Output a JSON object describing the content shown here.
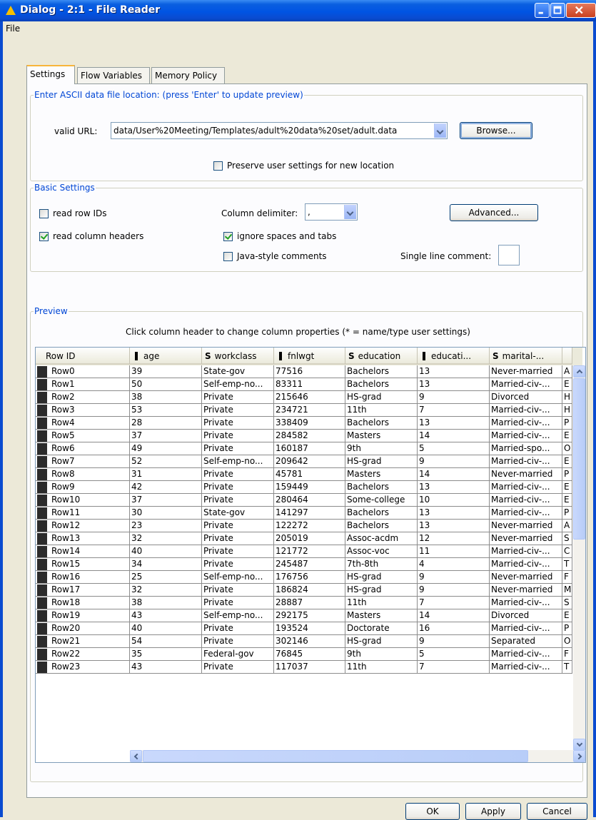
{
  "window": {
    "title": "Dialog - 2:1 - File Reader"
  },
  "menu": {
    "file": "File"
  },
  "tabs": [
    {
      "label": "Settings"
    },
    {
      "label": "Flow Variables"
    },
    {
      "label": "Memory Policy"
    }
  ],
  "location": {
    "legend": "Enter ASCII data file location: (press 'Enter' to update preview)",
    "url_label": "valid URL:",
    "url_value": "data/User%20Meeting/Templates/adult%20data%20set/adult.data",
    "browse_label": "Browse...",
    "preserve_label": "Preserve user settings for new location",
    "preserve_checked": false
  },
  "basic": {
    "legend": "Basic Settings",
    "read_row_ids": "read row IDs",
    "read_row_ids_checked": false,
    "read_col_headers": "read column headers",
    "read_col_headers_checked": true,
    "col_delim_label": "Column delimiter:",
    "col_delim_value": ",",
    "advanced_label": "Advanced...",
    "ignore_spaces": "ignore spaces and tabs",
    "ignore_spaces_checked": true,
    "java_comments": "Java-style comments",
    "java_comments_checked": false,
    "single_line_label": "Single line comment:",
    "single_line_value": ""
  },
  "preview": {
    "legend": "Preview",
    "hint": "Click column header to change column properties (* = name/type user settings)",
    "columns": [
      {
        "name": "Row ID",
        "type": ""
      },
      {
        "name": "age",
        "type": "I"
      },
      {
        "name": "workclass",
        "type": "S"
      },
      {
        "name": "fnlwgt",
        "type": "I"
      },
      {
        "name": "education",
        "type": "S"
      },
      {
        "name": "educati...",
        "type": "I"
      },
      {
        "name": "marital-...",
        "type": "S"
      },
      {
        "name": "",
        "type": ""
      }
    ],
    "rows": [
      [
        "Row0",
        "39",
        "State-gov",
        "77516",
        "Bachelors",
        "13",
        "Never-married",
        "A"
      ],
      [
        "Row1",
        "50",
        "Self-emp-no...",
        "83311",
        "Bachelors",
        "13",
        "Married-civ-...",
        "E"
      ],
      [
        "Row2",
        "38",
        "Private",
        "215646",
        "HS-grad",
        "9",
        "Divorced",
        "H"
      ],
      [
        "Row3",
        "53",
        "Private",
        "234721",
        "11th",
        "7",
        "Married-civ-...",
        "H"
      ],
      [
        "Row4",
        "28",
        "Private",
        "338409",
        "Bachelors",
        "13",
        "Married-civ-...",
        "P"
      ],
      [
        "Row5",
        "37",
        "Private",
        "284582",
        "Masters",
        "14",
        "Married-civ-...",
        "E"
      ],
      [
        "Row6",
        "49",
        "Private",
        "160187",
        "9th",
        "5",
        "Married-spo...",
        "O"
      ],
      [
        "Row7",
        "52",
        "Self-emp-no...",
        "209642",
        "HS-grad",
        "9",
        "Married-civ-...",
        "E"
      ],
      [
        "Row8",
        "31",
        "Private",
        "45781",
        "Masters",
        "14",
        "Never-married",
        "P"
      ],
      [
        "Row9",
        "42",
        "Private",
        "159449",
        "Bachelors",
        "13",
        "Married-civ-...",
        "E"
      ],
      [
        "Row10",
        "37",
        "Private",
        "280464",
        "Some-college",
        "10",
        "Married-civ-...",
        "E"
      ],
      [
        "Row11",
        "30",
        "State-gov",
        "141297",
        "Bachelors",
        "13",
        "Married-civ-...",
        "P"
      ],
      [
        "Row12",
        "23",
        "Private",
        "122272",
        "Bachelors",
        "13",
        "Never-married",
        "A"
      ],
      [
        "Row13",
        "32",
        "Private",
        "205019",
        "Assoc-acdm",
        "12",
        "Never-married",
        "S"
      ],
      [
        "Row14",
        "40",
        "Private",
        "121772",
        "Assoc-voc",
        "11",
        "Married-civ-...",
        "C"
      ],
      [
        "Row15",
        "34",
        "Private",
        "245487",
        "7th-8th",
        "4",
        "Married-civ-...",
        "T"
      ],
      [
        "Row16",
        "25",
        "Self-emp-no...",
        "176756",
        "HS-grad",
        "9",
        "Never-married",
        "F"
      ],
      [
        "Row17",
        "32",
        "Private",
        "186824",
        "HS-grad",
        "9",
        "Never-married",
        "M"
      ],
      [
        "Row18",
        "38",
        "Private",
        "28887",
        "11th",
        "7",
        "Married-civ-...",
        "S"
      ],
      [
        "Row19",
        "43",
        "Self-emp-no...",
        "292175",
        "Masters",
        "14",
        "Divorced",
        "E"
      ],
      [
        "Row20",
        "40",
        "Private",
        "193524",
        "Doctorate",
        "16",
        "Married-civ-...",
        "P"
      ],
      [
        "Row21",
        "54",
        "Private",
        "302146",
        "HS-grad",
        "9",
        "Separated",
        "O"
      ],
      [
        "Row22",
        "35",
        "Federal-gov",
        "76845",
        "9th",
        "5",
        "Married-civ-...",
        "F"
      ],
      [
        "Row23",
        "43",
        "Private",
        "117037",
        "11th",
        "7",
        "Married-civ-...",
        "T"
      ]
    ]
  },
  "buttons": {
    "ok": "OK",
    "apply": "Apply",
    "cancel": "Cancel"
  }
}
